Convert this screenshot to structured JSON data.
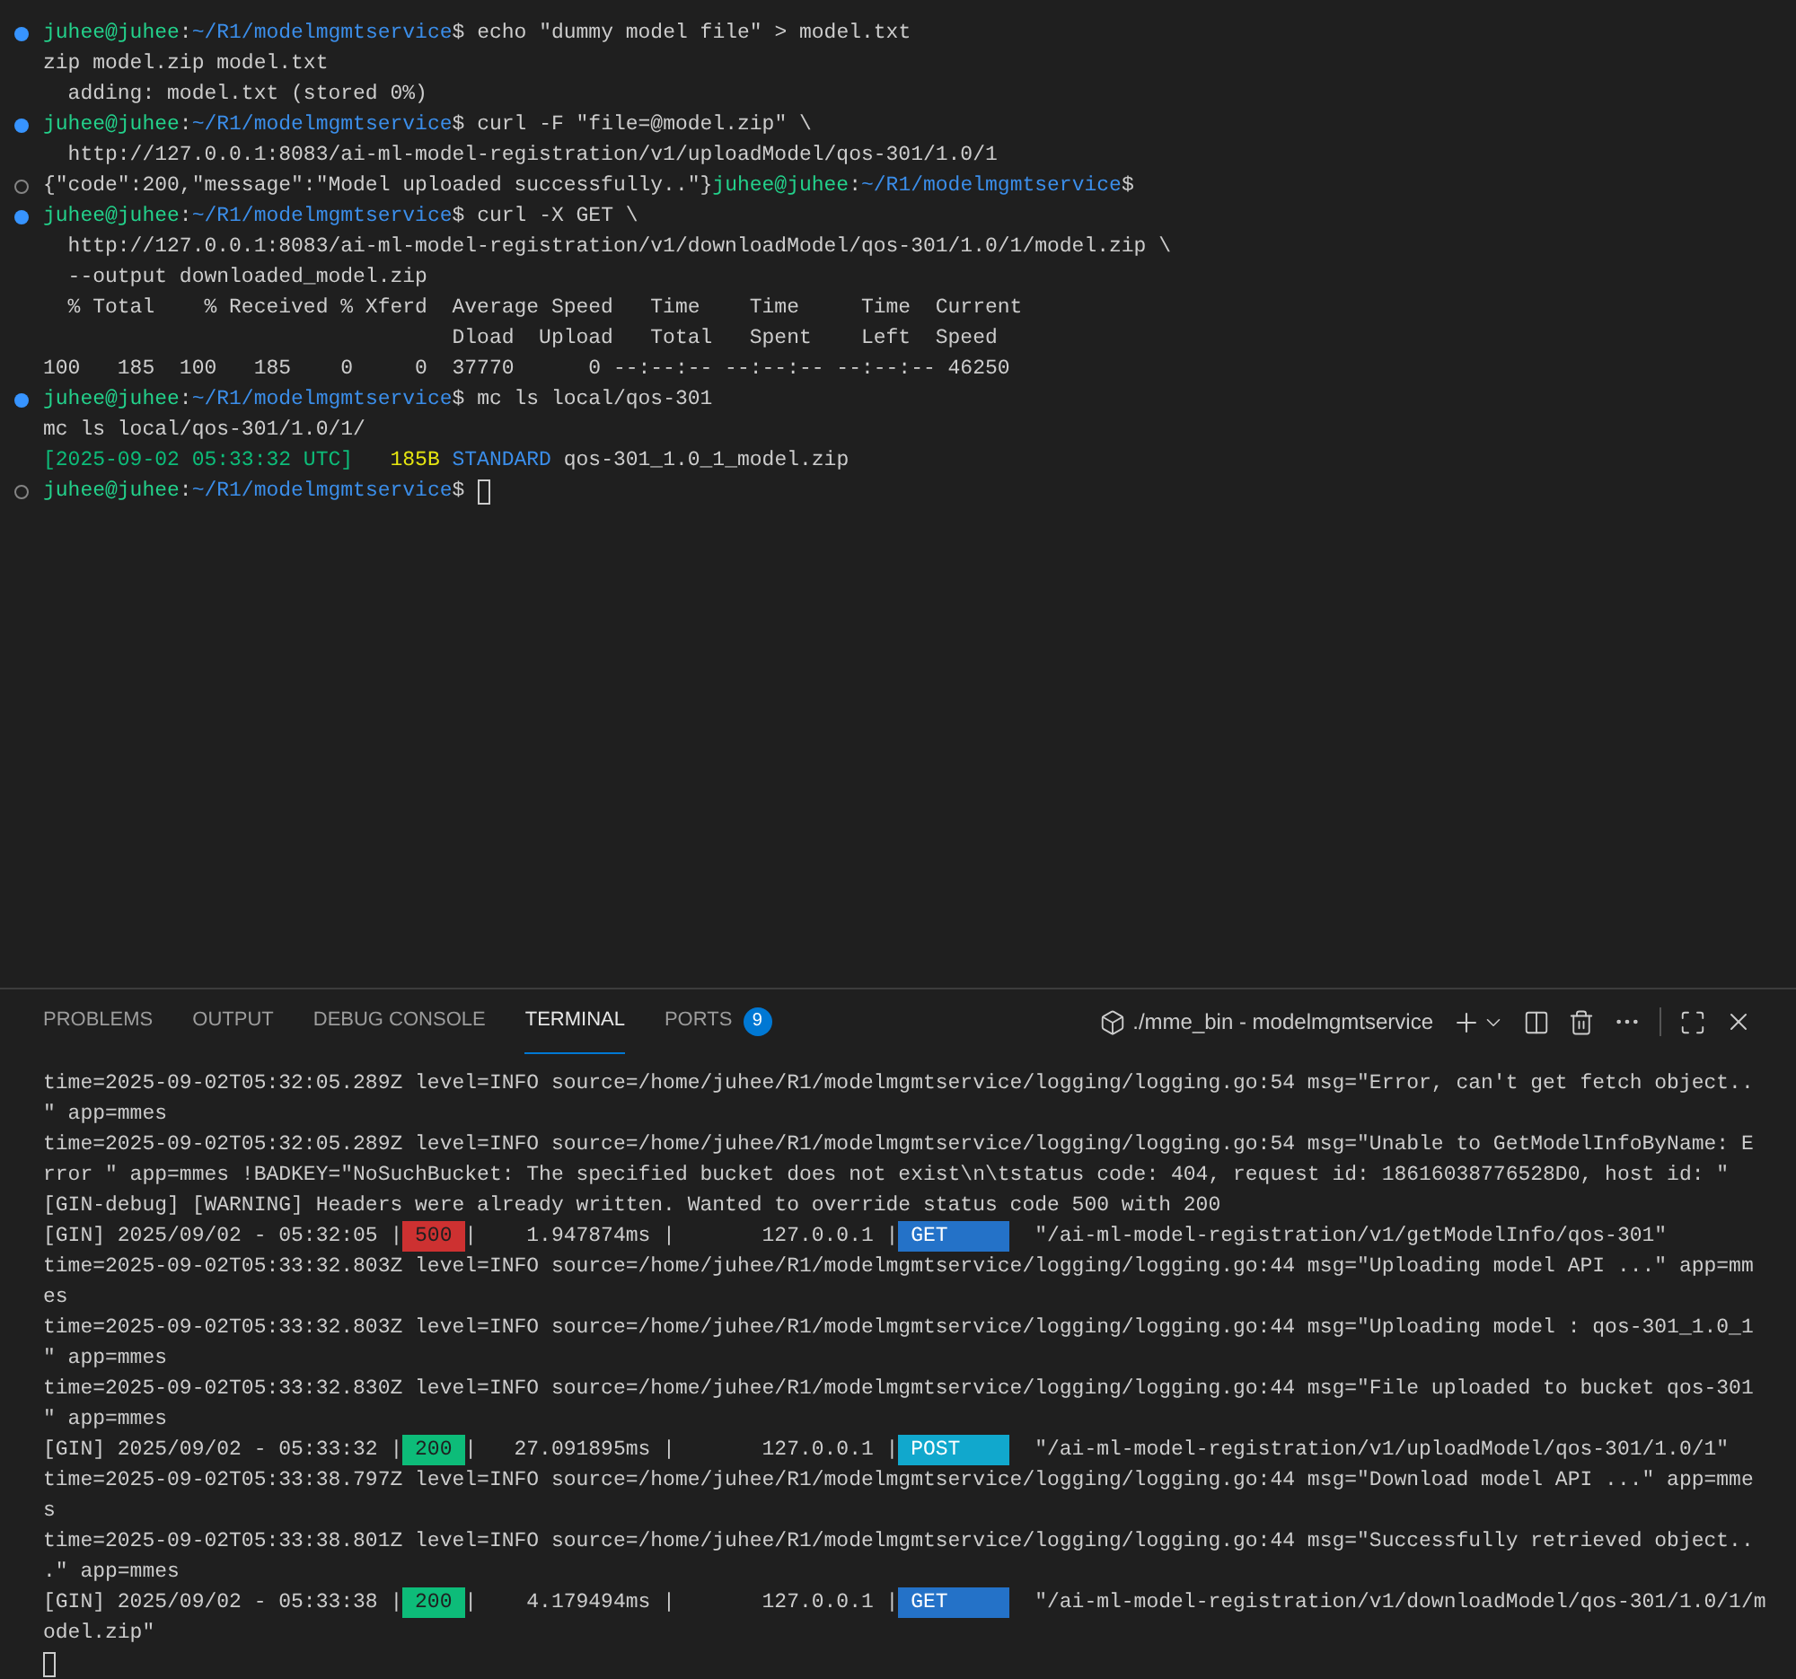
{
  "editor_terminal": {
    "lines": [
      {
        "marker_filled": true,
        "segments": [
          {
            "kind": "user",
            "text": "juhee@juhee"
          },
          {
            "kind": "plain",
            "text": ":"
          },
          {
            "kind": "path",
            "text": "~/R1/modelmgmtservice"
          },
          {
            "kind": "plain",
            "text": "$ echo \"dummy model file\" > model.txt"
          }
        ]
      },
      {
        "segments": [
          {
            "kind": "plain",
            "text": "zip model.zip model.txt"
          }
        ]
      },
      {
        "segments": [
          {
            "kind": "plain",
            "text": "  adding: model.txt (stored 0%)"
          }
        ]
      },
      {
        "marker_filled": true,
        "segments": [
          {
            "kind": "user",
            "text": "juhee@juhee"
          },
          {
            "kind": "plain",
            "text": ":"
          },
          {
            "kind": "path",
            "text": "~/R1/modelmgmtservice"
          },
          {
            "kind": "plain",
            "text": "$ curl -F \"file=@model.zip\" \\"
          }
        ]
      },
      {
        "segments": [
          {
            "kind": "plain",
            "text": "  http://127.0.0.1:8083/ai-ml-model-registration/v1/uploadModel/qos-301/1.0/1"
          }
        ]
      },
      {
        "marker_filled": false,
        "segments": [
          {
            "kind": "plain",
            "text": "{\"code\":200,\"message\":\"Model uploaded successfully..\"}"
          },
          {
            "kind": "user",
            "text": "juhee@juhee"
          },
          {
            "kind": "plain",
            "text": ":"
          },
          {
            "kind": "path",
            "text": "~/R1/modelmgmtservice"
          },
          {
            "kind": "plain",
            "text": "$"
          }
        ]
      },
      {
        "marker_filled": true,
        "segments": [
          {
            "kind": "user",
            "text": "juhee@juhee"
          },
          {
            "kind": "plain",
            "text": ":"
          },
          {
            "kind": "path",
            "text": "~/R1/modelmgmtservice"
          },
          {
            "kind": "plain",
            "text": "$ curl -X GET \\"
          }
        ]
      },
      {
        "segments": [
          {
            "kind": "plain",
            "text": "  http://127.0.0.1:8083/ai-ml-model-registration/v1/downloadModel/qos-301/1.0/1/model.zip \\"
          }
        ]
      },
      {
        "segments": [
          {
            "kind": "plain",
            "text": "  --output downloaded_model.zip"
          }
        ]
      },
      {
        "segments": [
          {
            "kind": "plain",
            "text": "  % Total    % Received % Xferd  Average Speed   Time    Time     Time  Current"
          }
        ]
      },
      {
        "segments": [
          {
            "kind": "plain",
            "text": "                                 Dload  Upload   Total   Spent    Left  Speed"
          }
        ]
      },
      {
        "segments": [
          {
            "kind": "plain",
            "text": "100   185  100   185    0     0  37770      0 --:--:-- --:--:-- --:--:-- 46250"
          }
        ]
      },
      {
        "marker_filled": true,
        "segments": [
          {
            "kind": "user",
            "text": "juhee@juhee"
          },
          {
            "kind": "plain",
            "text": ":"
          },
          {
            "kind": "path",
            "text": "~/R1/modelmgmtservice"
          },
          {
            "kind": "plain",
            "text": "$ mc ls local/qos-301"
          }
        ]
      },
      {
        "segments": [
          {
            "kind": "plain",
            "text": "mc ls local/qos-301/1.0/1/"
          }
        ]
      },
      {
        "segments": [
          {
            "kind": "date",
            "text": "[2025-09-02 05:33:32 UTC]"
          },
          {
            "kind": "size",
            "text": "   185B"
          },
          {
            "kind": "class",
            "text": " STANDARD"
          },
          {
            "kind": "plain",
            "text": " qos-301_1.0_1_model.zip"
          }
        ]
      },
      {
        "marker_filled": false,
        "cursor": true,
        "segments": [
          {
            "kind": "user",
            "text": "juhee@juhee"
          },
          {
            "kind": "plain",
            "text": ":"
          },
          {
            "kind": "path",
            "text": "~/R1/modelmgmtservice"
          },
          {
            "kind": "plain",
            "text": "$ "
          }
        ]
      }
    ]
  },
  "panel": {
    "tabs": [
      {
        "label": "PROBLEMS",
        "selected": false
      },
      {
        "label": "OUTPUT",
        "selected": false
      },
      {
        "label": "DEBUG CONSOLE",
        "selected": false
      },
      {
        "label": "TERMINAL",
        "selected": true
      },
      {
        "label": "PORTS",
        "selected": false,
        "badge": "9"
      }
    ],
    "terminal_name": "./mme_bin - modelmgmtservice",
    "log_lines": [
      {
        "segments": [
          {
            "kind": "plain",
            "text": "time=2025-09-02T05:32:05.289Z level=INFO source=/home/juhee/R1/modelmgmtservice/logging/logging.go:54 msg=\"Error, can't get fetch object.."
          }
        ]
      },
      {
        "segments": [
          {
            "kind": "plain",
            "text": "\" app=mmes"
          }
        ]
      },
      {
        "segments": [
          {
            "kind": "plain",
            "text": "time=2025-09-02T05:32:05.289Z level=INFO source=/home/juhee/R1/modelmgmtservice/logging/logging.go:54 msg=\"Unable to GetModelInfoByName: E"
          }
        ]
      },
      {
        "segments": [
          {
            "kind": "plain",
            "text": "rror \" app=mmes !BADKEY=\"NoSuchBucket: The specified bucket does not exist\\n\\tstatus code: 404, request id: 18616038776528D0, host id: \""
          }
        ]
      },
      {
        "segments": [
          {
            "kind": "plain",
            "text": "[GIN-debug] [WARNING] Headers were already written. Wanted to override status code 500 with 200"
          }
        ]
      },
      {
        "segments": [
          {
            "kind": "plain",
            "text": "[GIN] 2025/09/02 - 05:32:05 |"
          },
          {
            "kind": "status",
            "text": "500",
            "color": "#cd3131"
          },
          {
            "kind": "plain",
            "text": "|    1.947874ms |       127.0.0.1 |"
          },
          {
            "kind": "method",
            "text": "GET",
            "color": "#2472c8"
          },
          {
            "kind": "plain",
            "text": "  \"/ai-ml-model-registration/v1/getModelInfo/qos-301\""
          }
        ]
      },
      {
        "segments": [
          {
            "kind": "plain",
            "text": "time=2025-09-02T05:33:32.803Z level=INFO source=/home/juhee/R1/modelmgmtservice/logging/logging.go:44 msg=\"Uploading model API ...\" app=mm"
          }
        ]
      },
      {
        "segments": [
          {
            "kind": "plain",
            "text": "es"
          }
        ]
      },
      {
        "segments": [
          {
            "kind": "plain",
            "text": "time=2025-09-02T05:33:32.803Z level=INFO source=/home/juhee/R1/modelmgmtservice/logging/logging.go:44 msg=\"Uploading model : qos-301_1.0_1"
          }
        ]
      },
      {
        "segments": [
          {
            "kind": "plain",
            "text": "\" app=mmes"
          }
        ]
      },
      {
        "segments": [
          {
            "kind": "plain",
            "text": "time=2025-09-02T05:33:32.830Z level=INFO source=/home/juhee/R1/modelmgmtservice/logging/logging.go:44 msg=\"File uploaded to bucket qos-301"
          }
        ]
      },
      {
        "segments": [
          {
            "kind": "plain",
            "text": "\" app=mmes"
          }
        ]
      },
      {
        "segments": [
          {
            "kind": "plain",
            "text": "[GIN] 2025/09/02 - 05:33:32 |"
          },
          {
            "kind": "status",
            "text": "200",
            "color": "#0dbc79"
          },
          {
            "kind": "plain",
            "text": "|   27.091895ms |       127.0.0.1 |"
          },
          {
            "kind": "method",
            "text": "POST",
            "color": "#11a8cd"
          },
          {
            "kind": "plain",
            "text": "  \"/ai-ml-model-registration/v1/uploadModel/qos-301/1.0/1\""
          }
        ]
      },
      {
        "segments": [
          {
            "kind": "plain",
            "text": "time=2025-09-02T05:33:38.797Z level=INFO source=/home/juhee/R1/modelmgmtservice/logging/logging.go:44 msg=\"Download model API ...\" app=mme"
          }
        ]
      },
      {
        "segments": [
          {
            "kind": "plain",
            "text": "s"
          }
        ]
      },
      {
        "segments": [
          {
            "kind": "plain",
            "text": "time=2025-09-02T05:33:38.801Z level=INFO source=/home/juhee/R1/modelmgmtservice/logging/logging.go:44 msg=\"Successfully retrieved object.."
          }
        ]
      },
      {
        "segments": [
          {
            "kind": "plain",
            "text": ".\" app=mmes"
          }
        ]
      },
      {
        "segments": [
          {
            "kind": "plain",
            "text": "[GIN] 2025/09/02 - 05:33:38 |"
          },
          {
            "kind": "status",
            "text": "200",
            "color": "#0dbc79"
          },
          {
            "kind": "plain",
            "text": "|    4.179494ms |       127.0.0.1 |"
          },
          {
            "kind": "method",
            "text": "GET",
            "color": "#2472c8"
          },
          {
            "kind": "plain",
            "text": "  \"/ai-ml-model-registration/v1/downloadModel/qos-301/1.0/1/m"
          }
        ]
      },
      {
        "segments": [
          {
            "kind": "plain",
            "text": "odel.zip\""
          }
        ]
      },
      {
        "cursor": true
      }
    ]
  }
}
